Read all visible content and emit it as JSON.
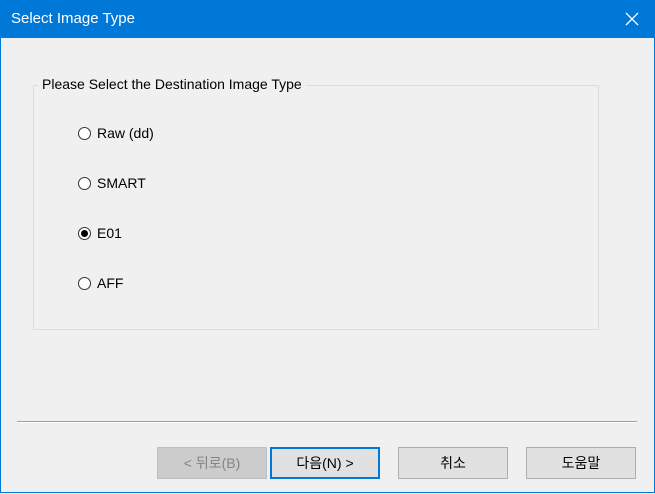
{
  "window": {
    "title": "Select Image Type",
    "close_glyph": "✕"
  },
  "group": {
    "label": "Please Select the Destination Image Type"
  },
  "options": [
    {
      "label": "Raw (dd)",
      "selected": false
    },
    {
      "label": "SMART",
      "selected": false
    },
    {
      "label": "E01",
      "selected": true
    },
    {
      "label": "AFF",
      "selected": false
    }
  ],
  "buttons": {
    "back": "< 뒤로(B)",
    "next": "다음(N) >",
    "cancel": "취소",
    "help": "도움말"
  },
  "colors": {
    "titlebar": "#0078d7",
    "background": "#f0f0f0"
  }
}
